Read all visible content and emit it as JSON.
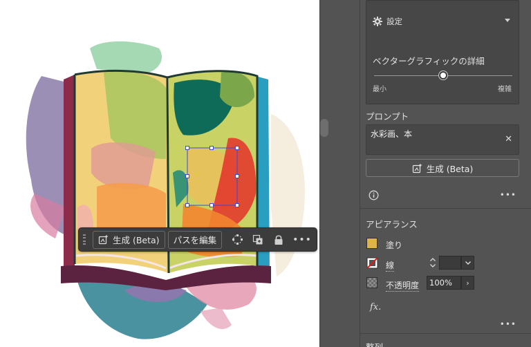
{
  "colors": {
    "panel_bg": "#535353",
    "panel_box": "#474747",
    "fill_color": "#e0b548",
    "selection": "#3a4bd8"
  },
  "context_bar": {
    "generate_label": "生成 (Beta)",
    "edit_path_label": "パスを編集",
    "more": "•••"
  },
  "settings": {
    "title": "設定",
    "detail_label": "ベクターグラフィックの詳細",
    "slider_min": "最小",
    "slider_max": "複雑",
    "detail_level": 0.5
  },
  "prompt": {
    "label": "プロンプト",
    "value": "水彩画、本",
    "clear": "✕"
  },
  "generate_button": {
    "label": "生成 (Beta)"
  },
  "more_label": "•••",
  "appearance": {
    "label": "アピアランス",
    "fill_label": "塗り",
    "stroke_label": "線",
    "stroke_weight": "",
    "opacity_label": "不透明度",
    "opacity_value": "100%",
    "fx": "fx."
  },
  "align": {
    "label": "整列"
  }
}
